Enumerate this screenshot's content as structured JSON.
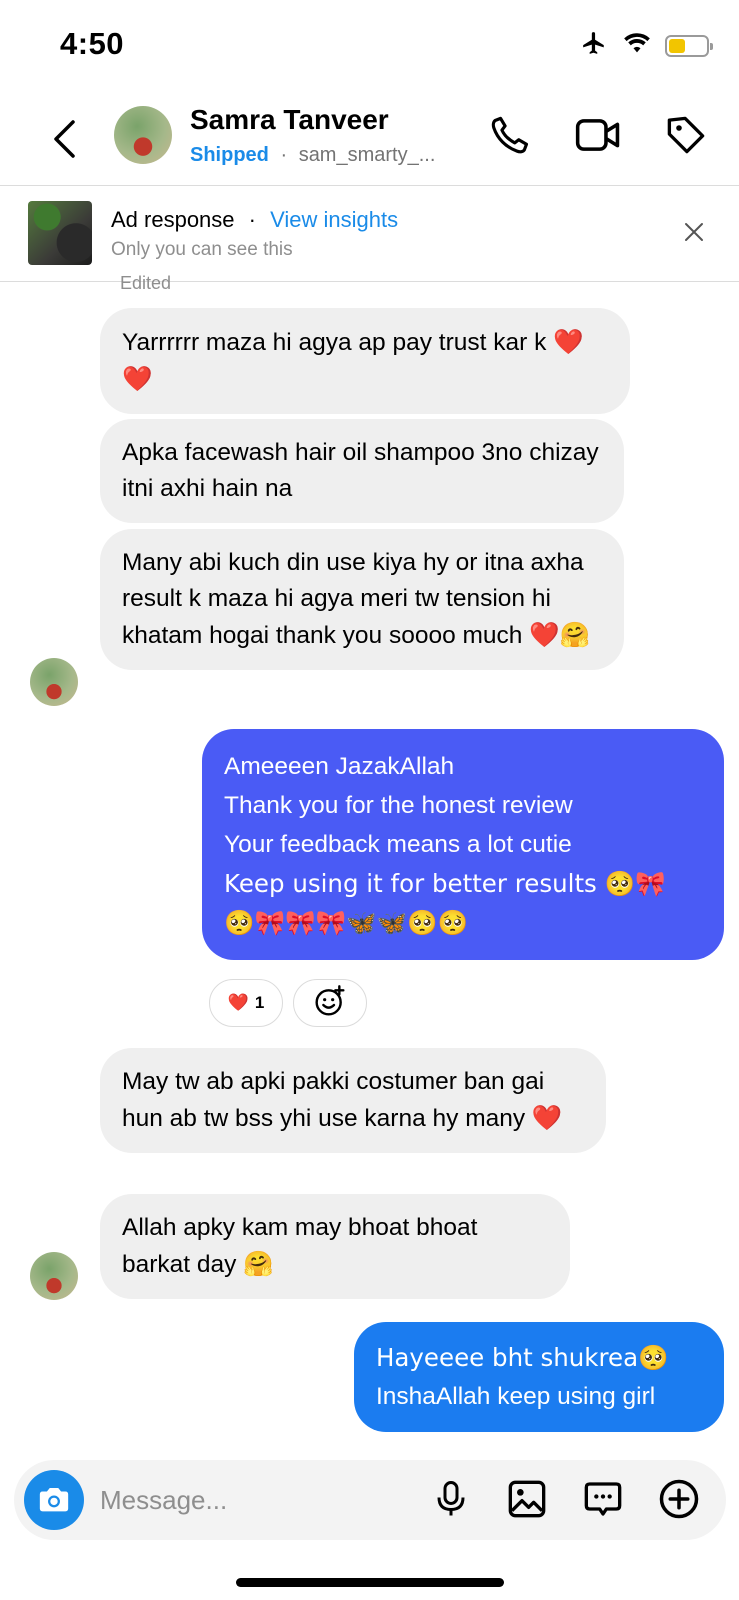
{
  "status_bar": {
    "time": "4:50",
    "icons": [
      "airplane-icon",
      "wifi-icon",
      "battery-icon"
    ],
    "battery_color": "#f2c500"
  },
  "header": {
    "name": "Samra Tanveer",
    "status": "Shipped",
    "separator": "·",
    "username": "sam_smarty_...",
    "icons": [
      "back-icon",
      "phone-icon",
      "video-icon",
      "tag-icon"
    ],
    "accent_color": "#1a8be8"
  },
  "ad_banner": {
    "title": "Ad response",
    "separator": "·",
    "link": "View insights",
    "note": "Only you can see this",
    "close_icon": "close-icon"
  },
  "edited_label": "Edited",
  "messages": [
    {
      "side": "incoming",
      "text": "Yarrrrrr maza hi agya ap pay trust kar k",
      "emoji": "❤️❤️"
    },
    {
      "side": "incoming",
      "text": "Apka facewash hair oil shampoo 3no chizay itni axhi hain na"
    },
    {
      "side": "incoming",
      "text": "Many abi kuch din use kiya hy or itna axha result k maza hi agya meri tw tension hi khatam hogai thank you soooo much",
      "emoji": "❤️🤗"
    },
    {
      "side": "outgoing",
      "lines": [
        "Ameeeen JazakAllah",
        "Thank you for the honest review",
        "Your feedback means a lot cutie",
        "Keep using it for better results 🥺🎀",
        "🥺🎀🎀🎀🦋🦋🥺🥺"
      ],
      "color": "#4a5bf5"
    },
    {
      "side": "incoming",
      "text": "May tw ab apki pakki costumer ban gai hun ab tw bss yhi use karna hy many",
      "emoji": "❤️"
    },
    {
      "side": "incoming",
      "text": "Allah apky kam may bhoat bhoat barkat day",
      "emoji": "🤗"
    },
    {
      "side": "outgoing",
      "lines": [
        "Hayeeee bht shukrea🥺",
        "InshaAllah keep using girl"
      ],
      "color": "#1b7cf0"
    }
  ],
  "reactions": {
    "heart": "❤️",
    "count": "1",
    "add_icon": "add-reaction-icon"
  },
  "composer": {
    "placeholder": "Message...",
    "icons": [
      "camera-icon",
      "microphone-icon",
      "gallery-icon",
      "sticker-icon",
      "plus-icon"
    ]
  }
}
